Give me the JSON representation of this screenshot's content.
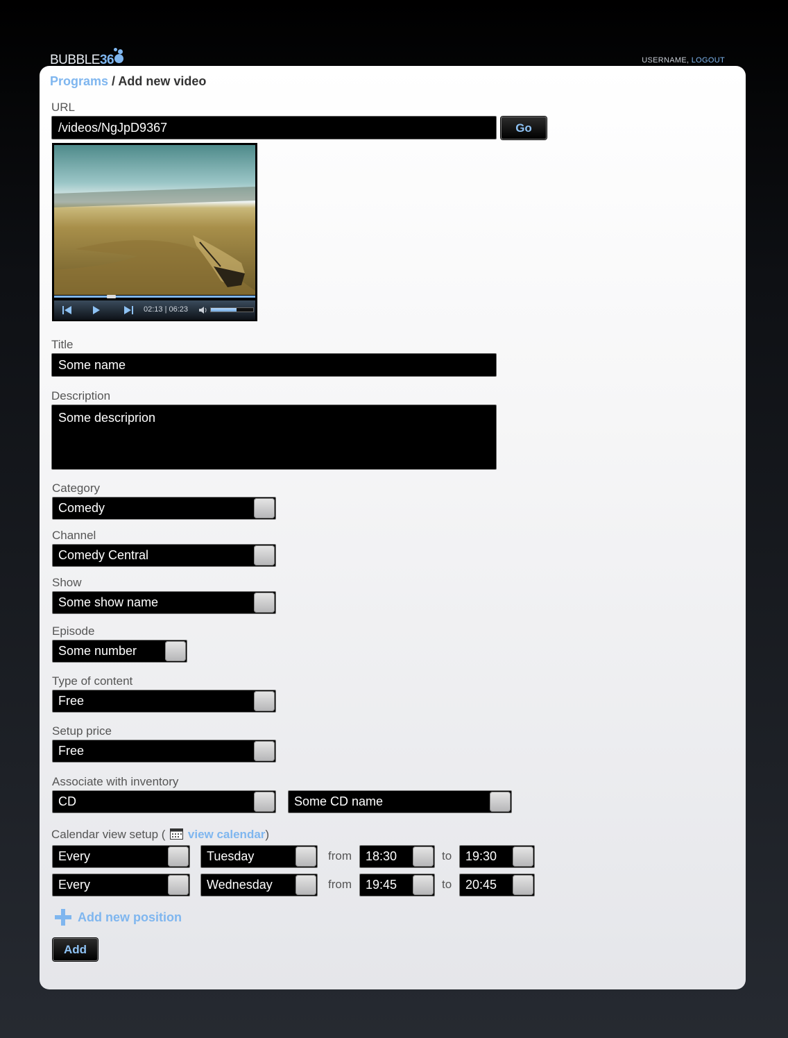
{
  "header": {
    "logo_word": "BUBBLE",
    "logo_num": "36",
    "username": "USERNAME,",
    "logout": "LOGOUT"
  },
  "breadcrumb": {
    "parent": "Programs",
    "separator": " / ",
    "current": "Add new video"
  },
  "url": {
    "label": "URL",
    "value": "/videos/NgJpD9367",
    "go": "Go"
  },
  "video": {
    "time": "02:13 | 06:23",
    "progress": 0.35,
    "volume": 0.6
  },
  "title": {
    "label": "Title",
    "value": "Some name"
  },
  "description": {
    "label": "Description",
    "value": "Some descriprion"
  },
  "category": {
    "label": "Category",
    "value": "Comedy"
  },
  "channel": {
    "label": "Channel",
    "value": "Comedy Central"
  },
  "show": {
    "label": "Show",
    "value": "Some show name"
  },
  "episode": {
    "label": "Episode",
    "value": "Some number"
  },
  "content_type": {
    "label": "Type of content",
    "value": "Free"
  },
  "setup_price": {
    "label": "Setup price",
    "value": "Free"
  },
  "inventory": {
    "label": "Associate with inventory",
    "type": "CD",
    "name": "Some CD name"
  },
  "calendar": {
    "label": "Calendar view setup (",
    "link": "view calendar",
    "close": ")",
    "rows": [
      {
        "freq": "Every",
        "day": "Tuesday",
        "from_label": "from",
        "from": "18:30",
        "to_label": "to",
        "to": "19:30"
      },
      {
        "freq": "Every",
        "day": "Wednesday",
        "from_label": "from",
        "from": "19:45",
        "to_label": "to",
        "to": "20:45"
      }
    ],
    "add_position": "Add new position"
  },
  "submit": "Add",
  "colors": {
    "accent": "#7fb6ef",
    "field_bg": "#000000"
  }
}
